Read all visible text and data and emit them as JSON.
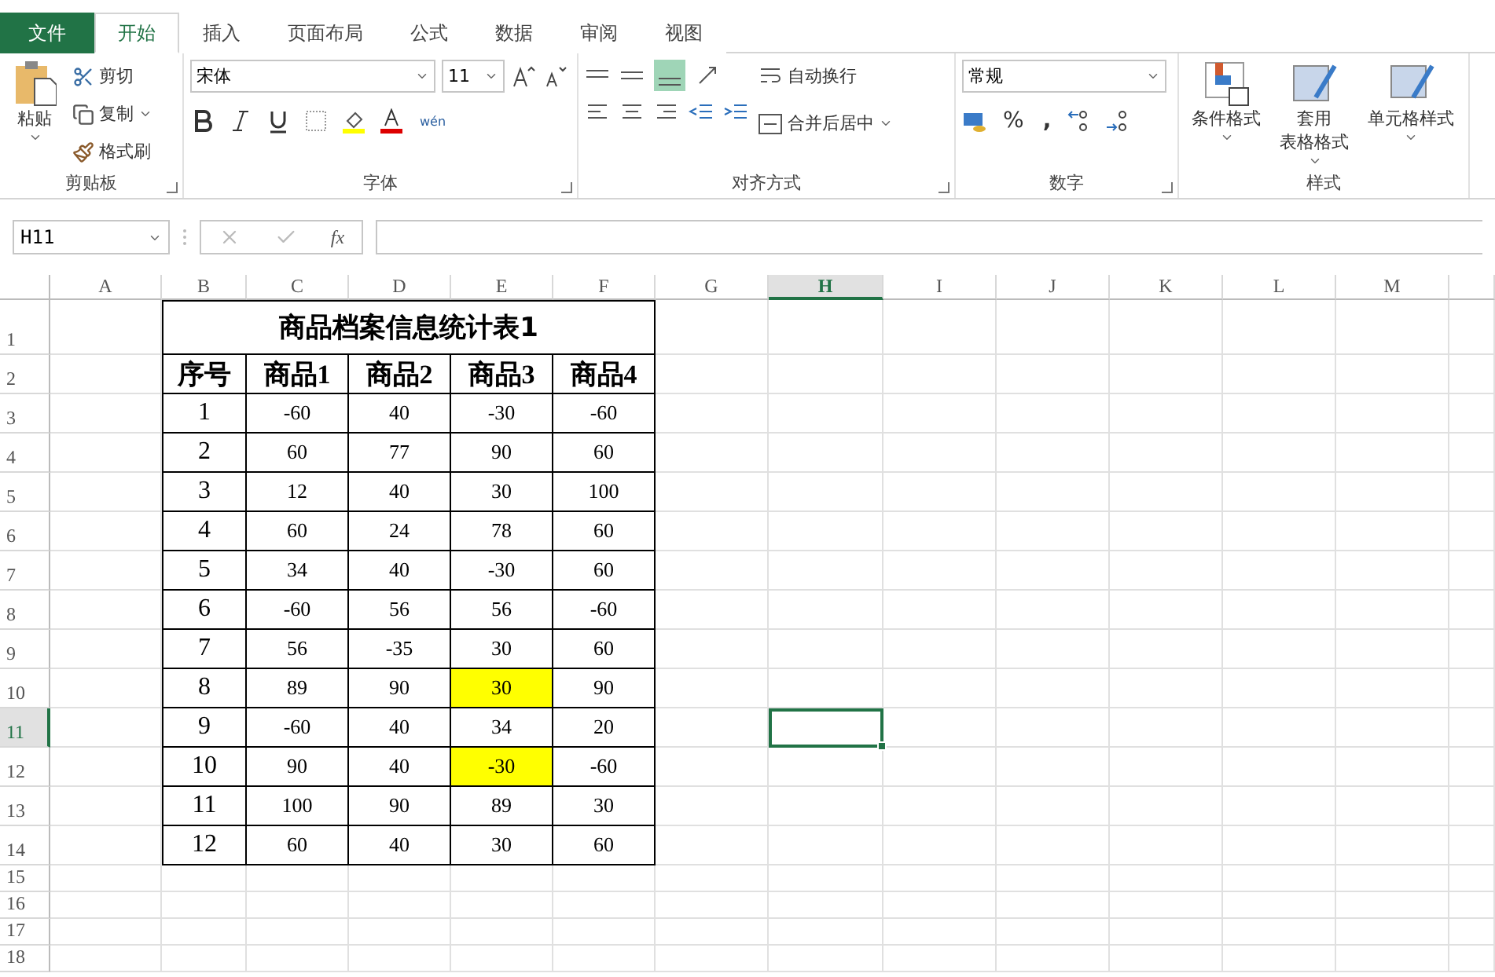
{
  "tabs": [
    {
      "label": "文件",
      "kind": "file",
      "selected": false
    },
    {
      "label": "开始",
      "kind": "tab",
      "selected": true
    },
    {
      "label": "插入",
      "kind": "tab",
      "selected": false
    },
    {
      "label": "页面布局",
      "kind": "tab",
      "selected": false
    },
    {
      "label": "公式",
      "kind": "tab",
      "selected": false
    },
    {
      "label": "数据",
      "kind": "tab",
      "selected": false
    },
    {
      "label": "审阅",
      "kind": "tab",
      "selected": false
    },
    {
      "label": "视图",
      "kind": "tab",
      "selected": false
    }
  ],
  "clipboard": {
    "label": "剪贴板",
    "paste": "粘贴",
    "cut": "剪切",
    "copy": "复制",
    "format_painter": "格式刷"
  },
  "font": {
    "label": "字体",
    "font_name": "宋体",
    "font_size": "11",
    "pinyin": "wén"
  },
  "alignment": {
    "label": "对齐方式",
    "wrap": "自动换行",
    "merge": "合并后居中"
  },
  "number": {
    "label": "数字",
    "format": "常规",
    "percent": "%",
    "comma": ","
  },
  "styles": {
    "label": "样式",
    "conditional": "条件格式",
    "table_format": [
      "套用",
      "表格格式"
    ],
    "cell_styles": "单元格样式"
  },
  "name_box": "H11",
  "fx": "fx",
  "columns": [
    {
      "label": "A",
      "selected": false
    },
    {
      "label": "B",
      "selected": false
    },
    {
      "label": "C",
      "selected": false
    },
    {
      "label": "D",
      "selected": false
    },
    {
      "label": "E",
      "selected": false
    },
    {
      "label": "F",
      "selected": false
    },
    {
      "label": "G",
      "selected": false
    },
    {
      "label": "H",
      "selected": true
    },
    {
      "label": "I",
      "selected": false
    },
    {
      "label": "J",
      "selected": false
    },
    {
      "label": "K",
      "selected": false
    },
    {
      "label": "L",
      "selected": false
    },
    {
      "label": "M",
      "selected": false
    }
  ],
  "rows": [
    {
      "label": "1",
      "selected": false
    },
    {
      "label": "2",
      "selected": false
    },
    {
      "label": "3",
      "selected": false
    },
    {
      "label": "4",
      "selected": false
    },
    {
      "label": "5",
      "selected": false
    },
    {
      "label": "6",
      "selected": false
    },
    {
      "label": "7",
      "selected": false
    },
    {
      "label": "8",
      "selected": false
    },
    {
      "label": "9",
      "selected": false
    },
    {
      "label": "10",
      "selected": false
    },
    {
      "label": "11",
      "selected": true
    },
    {
      "label": "12",
      "selected": false
    },
    {
      "label": "13",
      "selected": false
    },
    {
      "label": "14",
      "selected": false
    },
    {
      "label": "15",
      "selected": false
    },
    {
      "label": "16",
      "selected": false
    },
    {
      "label": "17",
      "selected": false
    },
    {
      "label": "18",
      "selected": false
    }
  ],
  "table": {
    "title": "商品档案信息统计表1",
    "headers": [
      "序号",
      "商品1",
      "商品2",
      "商品3",
      "商品4"
    ],
    "rows": [
      {
        "cells": [
          {
            "text": "1",
            "highlighted": false
          },
          {
            "text": "-60",
            "highlighted": false
          },
          {
            "text": "40",
            "highlighted": false
          },
          {
            "text": "-30",
            "highlighted": false
          },
          {
            "text": "-60",
            "highlighted": false
          }
        ]
      },
      {
        "cells": [
          {
            "text": "2",
            "highlighted": false
          },
          {
            "text": "60",
            "highlighted": false
          },
          {
            "text": "77",
            "highlighted": false
          },
          {
            "text": "90",
            "highlighted": false
          },
          {
            "text": "60",
            "highlighted": false
          }
        ]
      },
      {
        "cells": [
          {
            "text": "3",
            "highlighted": false
          },
          {
            "text": "12",
            "highlighted": false
          },
          {
            "text": "40",
            "highlighted": false
          },
          {
            "text": "30",
            "highlighted": false
          },
          {
            "text": "100",
            "highlighted": false
          }
        ]
      },
      {
        "cells": [
          {
            "text": "4",
            "highlighted": false
          },
          {
            "text": "60",
            "highlighted": false
          },
          {
            "text": "24",
            "highlighted": false
          },
          {
            "text": "78",
            "highlighted": false
          },
          {
            "text": "60",
            "highlighted": false
          }
        ]
      },
      {
        "cells": [
          {
            "text": "5",
            "highlighted": false
          },
          {
            "text": "34",
            "highlighted": false
          },
          {
            "text": "40",
            "highlighted": false
          },
          {
            "text": "-30",
            "highlighted": false
          },
          {
            "text": "60",
            "highlighted": false
          }
        ]
      },
      {
        "cells": [
          {
            "text": "6",
            "highlighted": false
          },
          {
            "text": "-60",
            "highlighted": false
          },
          {
            "text": "56",
            "highlighted": false
          },
          {
            "text": "56",
            "highlighted": false
          },
          {
            "text": "-60",
            "highlighted": false
          }
        ]
      },
      {
        "cells": [
          {
            "text": "7",
            "highlighted": false
          },
          {
            "text": "56",
            "highlighted": false
          },
          {
            "text": "-35",
            "highlighted": false
          },
          {
            "text": "30",
            "highlighted": false
          },
          {
            "text": "60",
            "highlighted": false
          }
        ]
      },
      {
        "cells": [
          {
            "text": "8",
            "highlighted": false
          },
          {
            "text": "89",
            "highlighted": false
          },
          {
            "text": "90",
            "highlighted": false
          },
          {
            "text": "30",
            "highlighted": true
          },
          {
            "text": "90",
            "highlighted": false
          }
        ]
      },
      {
        "cells": [
          {
            "text": "9",
            "highlighted": false
          },
          {
            "text": "-60",
            "highlighted": false
          },
          {
            "text": "40",
            "highlighted": false
          },
          {
            "text": "34",
            "highlighted": false
          },
          {
            "text": "20",
            "highlighted": false
          }
        ]
      },
      {
        "cells": [
          {
            "text": "10",
            "highlighted": false
          },
          {
            "text": "90",
            "highlighted": false
          },
          {
            "text": "40",
            "highlighted": false
          },
          {
            "text": "-30",
            "highlighted": true
          },
          {
            "text": "-60",
            "highlighted": false
          }
        ]
      },
      {
        "cells": [
          {
            "text": "11",
            "highlighted": false
          },
          {
            "text": "100",
            "highlighted": false
          },
          {
            "text": "90",
            "highlighted": false
          },
          {
            "text": "89",
            "highlighted": false
          },
          {
            "text": "30",
            "highlighted": false
          }
        ]
      },
      {
        "cells": [
          {
            "text": "12",
            "highlighted": false
          },
          {
            "text": "60",
            "highlighted": false
          },
          {
            "text": "40",
            "highlighted": false
          },
          {
            "text": "30",
            "highlighted": false
          },
          {
            "text": "60",
            "highlighted": false
          }
        ]
      }
    ]
  }
}
